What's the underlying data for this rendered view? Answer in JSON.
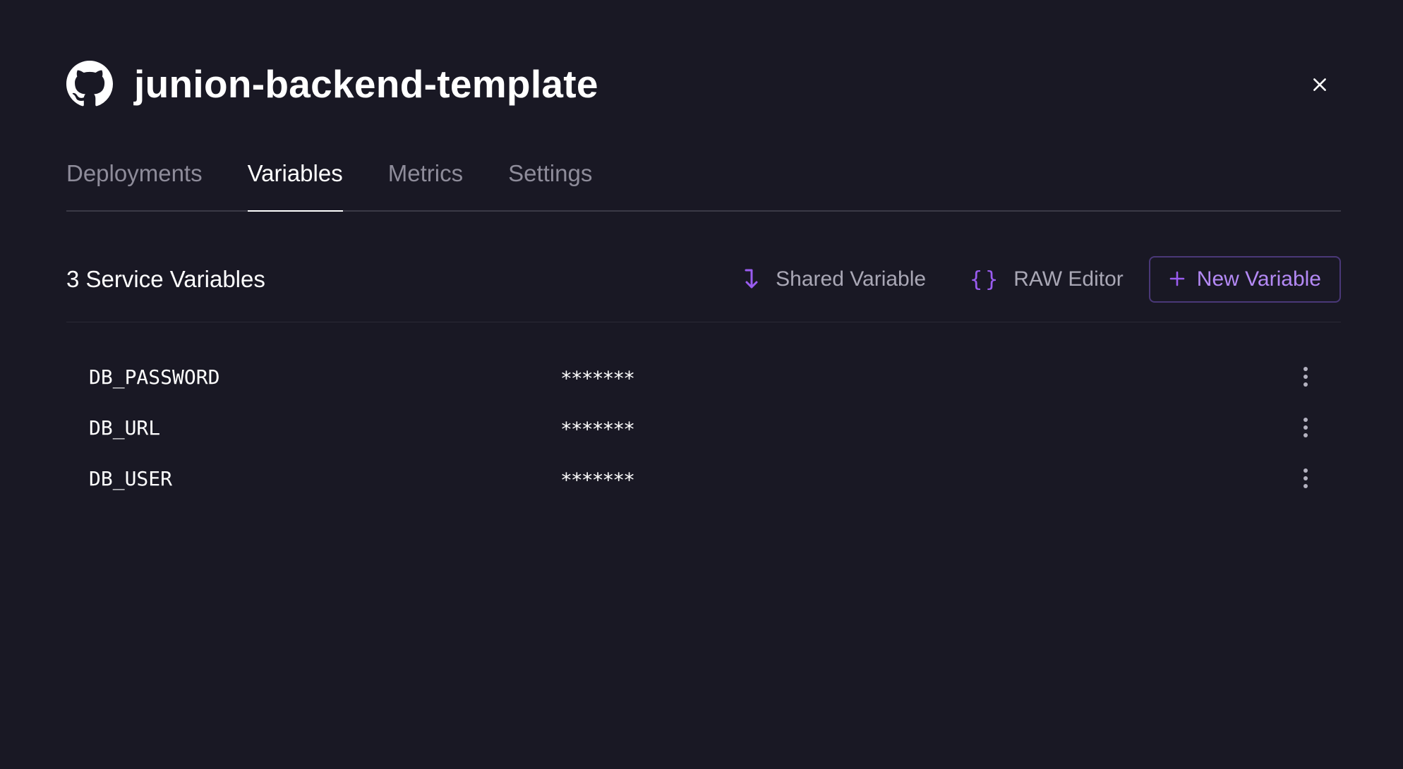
{
  "header": {
    "title": "junion-backend-template",
    "icon": "github-icon",
    "close_icon": "close-icon"
  },
  "tabs": [
    {
      "label": "Deployments",
      "active": false
    },
    {
      "label": "Variables",
      "active": true
    },
    {
      "label": "Metrics",
      "active": false
    },
    {
      "label": "Settings",
      "active": false
    }
  ],
  "toolbar": {
    "count_label": "3 Service Variables",
    "shared_label": "Shared Variable",
    "shared_icon": "arrow-down-right-icon",
    "raw_label": "RAW Editor",
    "raw_icon": "braces-icon",
    "new_label": "New Variable",
    "new_icon": "plus-icon"
  },
  "variables": [
    {
      "name": "DB_PASSWORD",
      "value": "*******"
    },
    {
      "name": "DB_URL",
      "value": "*******"
    },
    {
      "name": "DB_USER",
      "value": "*******"
    }
  ],
  "colors": {
    "background": "#191824",
    "accent": "#9a5cf0",
    "accent_text": "#b489f5",
    "muted_text": "#8e8c9a"
  }
}
